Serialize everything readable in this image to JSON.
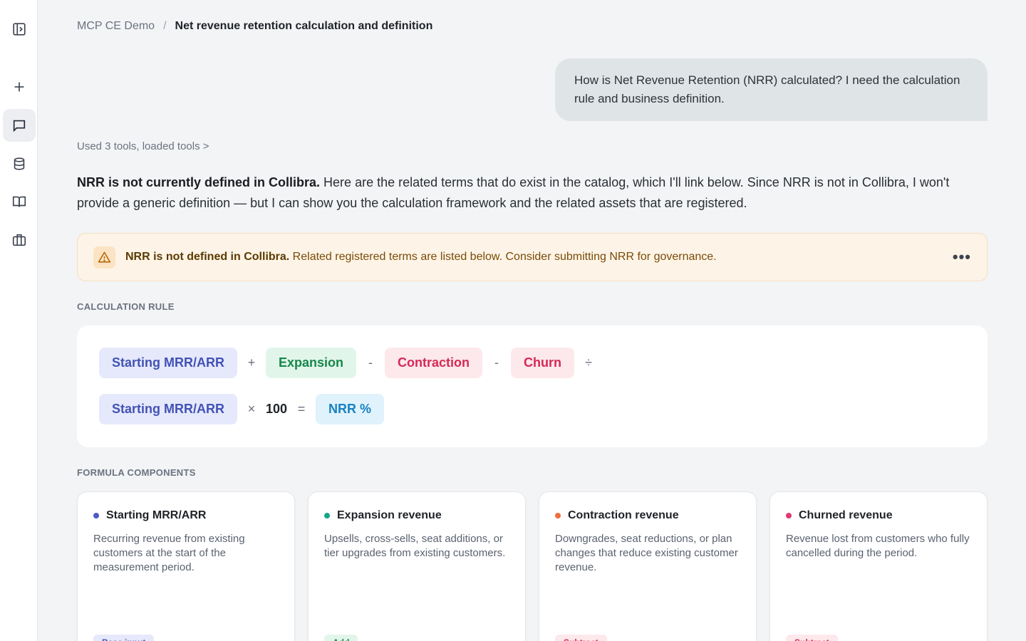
{
  "breadcrumb": {
    "root": "MCP CE Demo",
    "separator": "/",
    "current": "Net revenue retention calculation and definition"
  },
  "user_message": "How is Net Revenue Retention (NRR) calculated? I need the calculation rule and business definition.",
  "tools_line": "Used 3 tools, loaded tools >",
  "answer": {
    "bold": "NRR is not currently defined in Collibra.",
    "text": " Here are the related terms that do exist in the catalog, which I'll link below. Since NRR is not in Collibra, I won't provide a generic definition — but I can show you the calculation framework and the related assets that are registered."
  },
  "alert": {
    "bold": "NRR is not defined in Collibra.",
    "text": " Related registered terms are listed below. Consider submitting NRR for governance.",
    "more": "•••"
  },
  "calc_label": "CALCULATION RULE",
  "formula": {
    "row1": [
      {
        "kind": "chip",
        "color": "blue",
        "text": "Starting MRR/ARR"
      },
      {
        "kind": "op",
        "text": "+"
      },
      {
        "kind": "chip",
        "color": "green",
        "text": "Expansion"
      },
      {
        "kind": "op",
        "text": "-"
      },
      {
        "kind": "chip",
        "color": "red",
        "text": "Contraction"
      },
      {
        "kind": "op",
        "text": "-"
      },
      {
        "kind": "chip",
        "color": "red",
        "text": "Churn"
      },
      {
        "kind": "op",
        "text": "÷"
      }
    ],
    "row2": [
      {
        "kind": "chip",
        "color": "blue",
        "text": "Starting MRR/ARR"
      },
      {
        "kind": "op",
        "text": "×"
      },
      {
        "kind": "num",
        "text": "100"
      },
      {
        "kind": "op",
        "text": "="
      },
      {
        "kind": "chip",
        "color": "cyan",
        "text": "NRR %"
      }
    ]
  },
  "components_label": "FORMULA COMPONENTS",
  "components": [
    {
      "title": "Starting MRR/ARR",
      "dot": "#4d5bc4",
      "desc": "Recurring revenue from existing customers at the start of the measurement period.",
      "tag": "Base input",
      "tag_bg": "#e6e9fb",
      "tag_fg": "#4252b5"
    },
    {
      "title": "Expansion revenue",
      "dot": "#17a589",
      "desc": "Upsells, cross-sells, seat additions, or tier upgrades from existing customers.",
      "tag": "Add",
      "tag_bg": "#e2f5ea",
      "tag_fg": "#15884a"
    },
    {
      "title": "Contraction revenue",
      "dot": "#f0703a",
      "desc": "Downgrades, seat reductions, or plan changes that reduce existing customer revenue.",
      "tag": "Subtract",
      "tag_bg": "#fde8ec",
      "tag_fg": "#d42a55"
    },
    {
      "title": "Churned revenue",
      "dot": "#e03a6f",
      "desc": "Revenue lost from customers who fully cancelled during the period.",
      "tag": "Subtract",
      "tag_bg": "#fde8ec",
      "tag_fg": "#d42a55"
    }
  ],
  "sidebar_icons": [
    "panel-toggle-icon",
    "plus-icon",
    "chat-icon",
    "database-icon",
    "book-icon",
    "briefcase-icon"
  ]
}
